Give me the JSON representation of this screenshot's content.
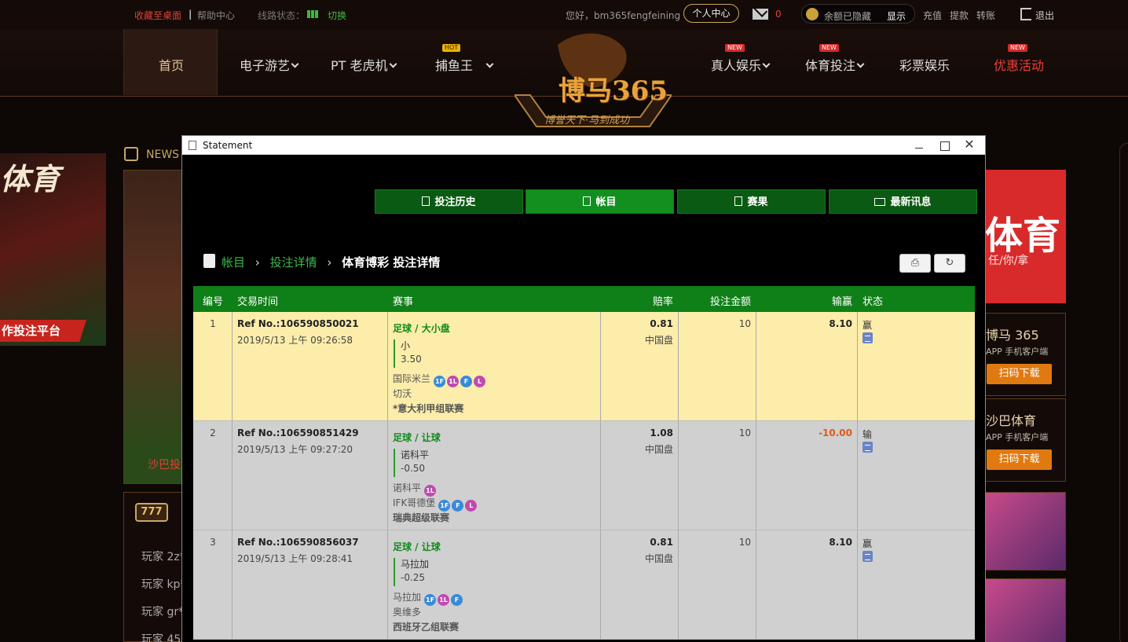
{
  "topbar": {
    "fav": "收藏至桌面",
    "sep": "|",
    "help": "帮助中心",
    "line_status": "线路状态：",
    "switch": "切换",
    "hello": "您好，bm365fengfeining",
    "user_center": "个人中心",
    "mail_count": "0",
    "balance_hidden": "余额已隐藏",
    "show": "显示",
    "recharge": "充值",
    "withdraw": "提款",
    "transfer": "转账",
    "logout": "退出"
  },
  "nav": {
    "home": "首页",
    "egame": "电子游艺",
    "pt": "PT 老虎机",
    "fish": "捕鱼王",
    "fish_badge": "HOT",
    "live": "真人娱乐",
    "live_badge": "NEW",
    "sports": "体育投注",
    "sports_badge": "NEW",
    "lottery": "彩票娱乐",
    "promo": "优惠活动",
    "promo_badge": "NEW"
  },
  "logo": {
    "text": "博马365",
    "slogan": "博誉天下·马到成功"
  },
  "background": {
    "left_title": "体育",
    "left_banner": "作投注平台",
    "news": "NEWS",
    "mid_label": "沙巴投",
    "slot_icon": "777",
    "players": [
      "玩家 2z*",
      "玩家 kp*",
      "玩家 gr*",
      "玩家 45*"
    ],
    "right_banner_big": "体育",
    "right_banner_sub": "任/你/拿",
    "apps": [
      {
        "title": "博马 365",
        "subtitle": "APP 手机客户端",
        "button": "扫码下载"
      },
      {
        "title": "沙巴体育",
        "subtitle": "APP 手机客户端",
        "button": "扫码下载"
      }
    ]
  },
  "window": {
    "title": "Statement",
    "close": "✕"
  },
  "tabs": [
    {
      "label": "投注历史"
    },
    {
      "label": "帐目"
    },
    {
      "label": "赛果"
    },
    {
      "label": "最新讯息"
    }
  ],
  "breadcrumb": {
    "item1": "帐目",
    "item2": "投注详情",
    "current": "体育博彩 投注详情",
    "sep": "›"
  },
  "table": {
    "headers": {
      "no": "编号",
      "time": "交易时间",
      "event": "赛事",
      "odds": "赔率",
      "stake": "投注金额",
      "winloss": "输赢",
      "status": "状态"
    },
    "rows": [
      {
        "no": "1",
        "ref": "Ref No.:106590850021",
        "date": "2019/5/13 上午 09:26:58",
        "sport": "足球 / 大小盘",
        "selection": "小",
        "handicap": "3.50",
        "team1": "国际米兰",
        "team1_marks": [
          "1F",
          "1L",
          "F",
          "L"
        ],
        "team2": "切沃",
        "team2_marks": [],
        "league": "*意大利甲组联赛",
        "odds": "0.81",
        "odds_type": "中国盘",
        "stake": "10",
        "winloss": "8.10",
        "status": "赢"
      },
      {
        "no": "2",
        "ref": "Ref No.:106590851429",
        "date": "2019/5/13 上午 09:27:20",
        "sport": "足球 / 让球",
        "selection": "诺科平",
        "handicap": "-0.50",
        "team1": "诺科平",
        "team1_marks": [
          "1L"
        ],
        "team2": "IFK哥德堡",
        "team2_marks": [
          "1F",
          "F",
          "L"
        ],
        "league": "瑞典超级联赛",
        "odds": "1.08",
        "odds_type": "中国盘",
        "stake": "10",
        "winloss": "-10.00",
        "status": "输"
      },
      {
        "no": "3",
        "ref": "Ref No.:106590856037",
        "date": "2019/5/13 上午 09:28:41",
        "sport": "足球 / 让球",
        "selection": "马拉加",
        "handicap": "-0.25",
        "team1": "马拉加",
        "team1_marks": [
          "1F",
          "1L",
          "F"
        ],
        "team2": "奥维多",
        "team2_marks": [],
        "league": "西班牙乙组联赛",
        "odds": "0.81",
        "odds_type": "中国盘",
        "stake": "10",
        "winloss": "8.10",
        "status": "赢"
      }
    ]
  },
  "colors": {
    "tab_green": "#0b5a13",
    "header_green": "#0f7f17",
    "row_win": "#fcedaa",
    "row_loss": "#d0d0d0",
    "negative": "#e05a1a",
    "link_green": "#3db84a"
  }
}
